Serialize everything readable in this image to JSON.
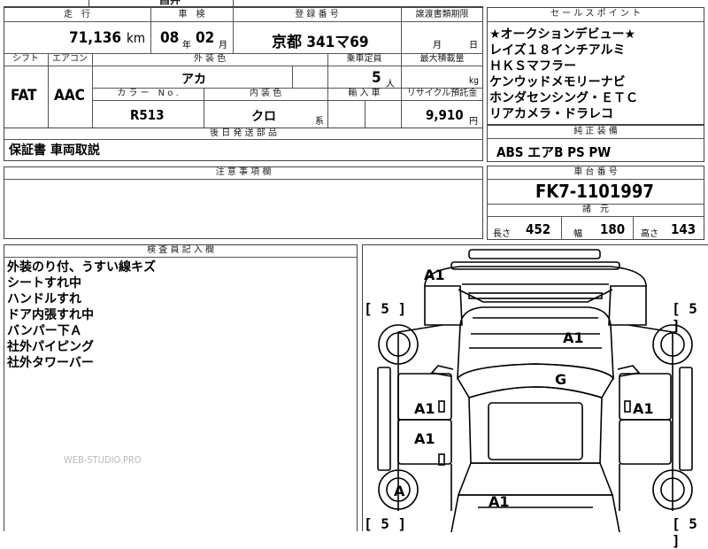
{
  "header": {
    "mileage_label": "走　行",
    "mileage_value": "71,136",
    "mileage_unit": "km",
    "inspection_label": "車　検",
    "inspection_year": "08",
    "year_unit": "年",
    "inspection_month": "02",
    "month_unit": "月",
    "registration_label": "登 録 番 号",
    "registration_value": "京都 341マ69",
    "transfer_label": "譲渡書類期限",
    "transfer_month_unit": "月",
    "transfer_day_unit": "日",
    "topcut": "昌井"
  },
  "specs": {
    "shift_label": "シフト",
    "shift_value": "FAT",
    "aircon_label": "エアコン",
    "aircon_value": "AAC",
    "exterior_label": "外 装 色",
    "exterior_value": "アカ",
    "capacity_label": "乗車定員",
    "capacity_value": "5",
    "capacity_unit": "人",
    "maxload_label": "最大積載量",
    "maxload_unit": "kg",
    "colorno_label": "カ ラ ー　N o .",
    "colorno_value": "R513",
    "interior_label": "内 装 色",
    "interior_value": "クロ",
    "interior_unit": "系",
    "import_label": "輸 入 車",
    "recycle_label": "リサイクル預託金",
    "recycle_value": "9,910",
    "recycle_unit": "円"
  },
  "documents": {
    "label": "後 日 発 送 部 品",
    "value": "保証書 車両取説"
  },
  "caution": {
    "label": "注 意 事 項 欄"
  },
  "sales_points": {
    "label": "セ ー ル ス ポ イ ン ト",
    "lines": [
      "★オークションデビュー★",
      "レイズ１８インチアルミ",
      "ＨＫＳマフラー",
      "ケンウッドメモリーナビ",
      "ホンダセンシング・ＥＴＣ",
      "リアカメラ・ドラレコ"
    ]
  },
  "equipment": {
    "label": "純 正 装 備",
    "value": "ABS エアB PS PW"
  },
  "chassis": {
    "label": "車 台 番 号",
    "value": "FK7-1101997"
  },
  "dims": {
    "label": "諸　元",
    "length_label": "長さ",
    "length_value": "452",
    "width_label": "幅",
    "width_value": "180",
    "height_label": "高さ",
    "height_value": "143"
  },
  "inspector": {
    "label": "検 査 員 記 入 欄",
    "lines": [
      "外装のり付、うすい線キズ",
      "シートすれ中",
      "ハンドルすれ",
      "ドア内張すれ中",
      "バンパー下Ａ",
      "社外パイピング",
      "社外タワーバー"
    ]
  },
  "diagram": {
    "tire_fl": "5",
    "tire_fr": "5",
    "tire_rl": "5",
    "tire_rr": "5",
    "front_bumper": "A1",
    "hood": "A1",
    "windshield": "G",
    "left_front_door": "A1",
    "right_front_door": "A1",
    "left_rear_door": "A1",
    "rear_left_wheel": "A",
    "trunk": "A1"
  },
  "watermark": "WEB-STUDIO.PRO"
}
